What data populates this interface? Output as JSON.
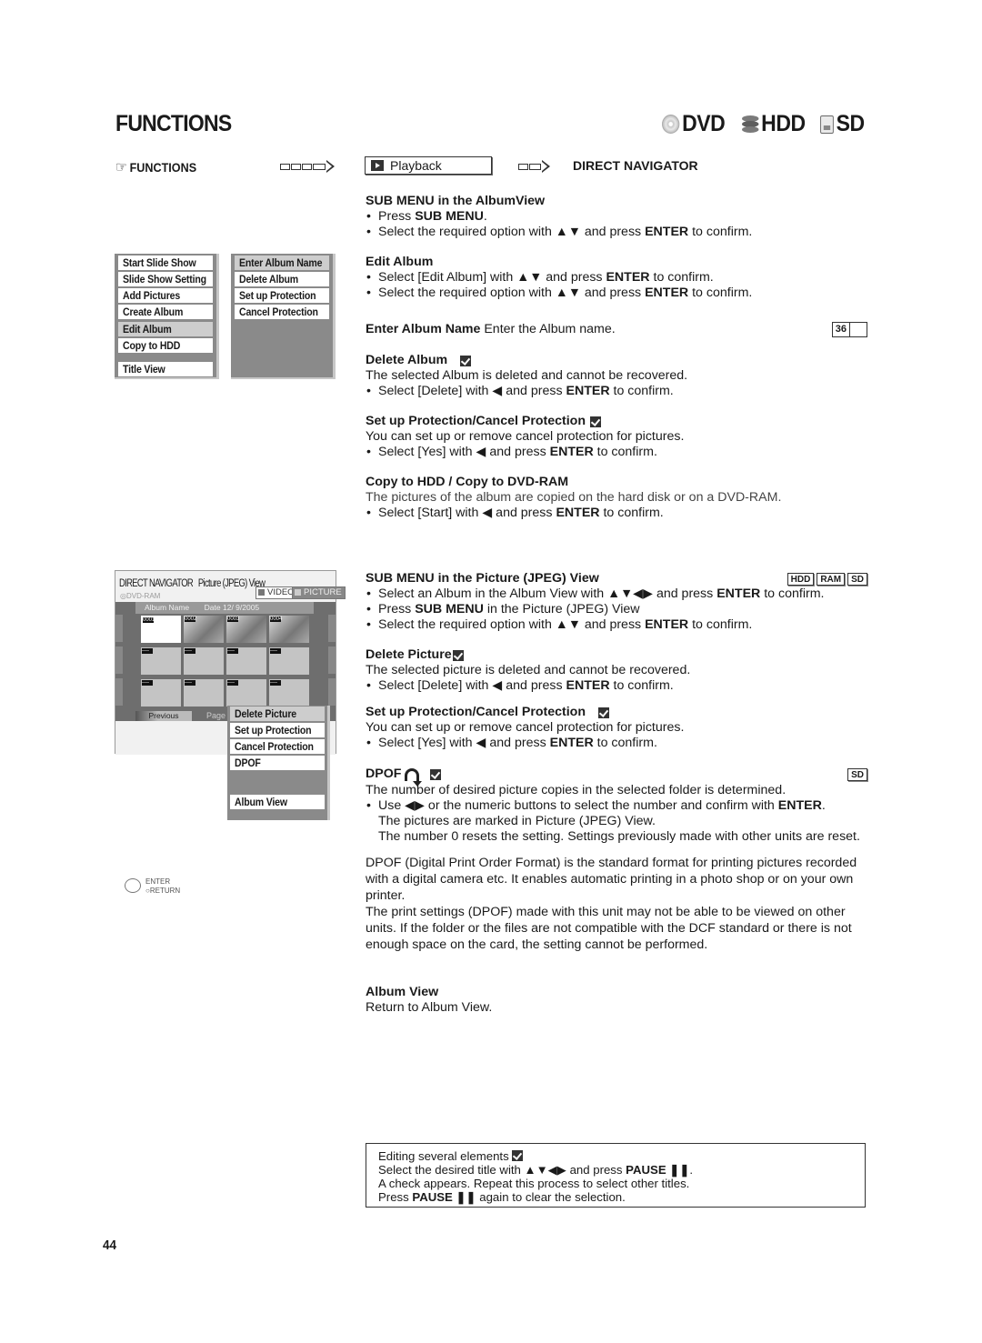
{
  "header": {
    "title": "FUNCTIONS",
    "media": [
      {
        "icon": "dvd-disc-icon",
        "label": "DVD"
      },
      {
        "icon": "hdd-icon",
        "label": "HDD"
      },
      {
        "icon": "sd-card-icon",
        "label": "SD"
      }
    ]
  },
  "nav_path": {
    "start": "FUNCTIONS",
    "middle": "Playback",
    "end": "DIRECT NAVIGATOR"
  },
  "album_menu": {
    "items": [
      "Start Slide Show",
      "Slide Show Setting",
      "Add Pictures",
      "Create Album",
      "Edit Album",
      "Copy to HDD",
      "Title View"
    ],
    "selected": "Edit Album"
  },
  "edit_album_menu": {
    "items": [
      "Enter Album Name",
      "Delete Album",
      "Set up Protection",
      "Cancel Protection"
    ],
    "selected": "Enter Album Name"
  },
  "screen": {
    "title": "DIRECT NAVIGATOR",
    "subtitle": "Picture (JPEG) View",
    "media": "DVD-RAM",
    "tab_video": "VIDEO",
    "tab_picture": "PICTURE",
    "album_name_label": "Album Name",
    "date_label": "Date  12/ 9/2005",
    "thumbnails": [
      "0001",
      "0002",
      "0003",
      "0004",
      "----",
      "----",
      "----",
      "----",
      "----",
      "----",
      "----",
      "----"
    ],
    "previous_label": "Previous",
    "page_label": "Page 0",
    "enter_label": "ENTER",
    "return_label": "RETURN"
  },
  "picture_menu": {
    "items": [
      "Delete Picture",
      "Set up Protection",
      "Cancel Protection",
      "DPOF",
      "Album View"
    ],
    "selected": "Delete Picture"
  },
  "sections": {
    "album_view": {
      "heading": "SUB MENU in the AlbumView",
      "b1_pre": "Press ",
      "b1_bold": "SUB MENU",
      "b1_post": ".",
      "b2_pre": "Select the required option with  ▲▼ and press ",
      "b2_bold": "ENTER",
      "b2_post": " to confirm."
    },
    "edit_album": {
      "heading": "Edit Album",
      "b1_pre": "Select [Edit Album] with ▲▼  and press ",
      "b1_bold": "ENTER",
      "b1_post": " to confirm.",
      "b2_pre": "Select the required option with ▲▼ and press ",
      "b2_bold": "ENTER",
      "b2_post": " to confirm."
    },
    "enter_album_name": {
      "heading": "Enter Album Name",
      "text": " Enter the Album name.",
      "page_ref": "36"
    },
    "delete_album": {
      "heading": "Delete Album",
      "text": "The selected Album is deleted and cannot be recovered.",
      "b1_pre": "Select [Delete] with ◀ and press ",
      "b1_bold": "ENTER",
      "b1_post": " to confirm."
    },
    "protection_album": {
      "heading": "Set up Protection/Cancel Protection",
      "text": "You can set up or remove cancel protection for pictures.",
      "b1_pre": "Select [Yes] with ◀ and press ",
      "b1_bold": "ENTER",
      "b1_post": " to confirm."
    },
    "copy": {
      "heading": "Copy to HDD / Copy to DVD-RAM",
      "text": "The pictures of the album are copied on the hard disk or on a DVD-RAM.",
      "b1_pre": "Select [Start] with ◀  and press ",
      "b1_bold": "ENTER",
      "b1_post": " to confirm."
    },
    "jpeg_view": {
      "heading": "SUB MENU in the Picture (JPEG) View",
      "badges": [
        "HDD",
        "RAM",
        "SD"
      ],
      "b1_pre": "Select an Album in the  Album View with ▲▼◀▶  and press  ",
      "b1_bold": "ENTER",
      "b1_post": " to confirm.",
      "b2_pre": "Press ",
      "b2_bold": "SUB MENU",
      "b2_post": " in the Picture (JPEG) View",
      "b3_pre": "Select the required option with ▲▼ and press ",
      "b3_bold": "ENTER",
      "b3_post": " to confirm."
    },
    "delete_picture": {
      "heading": "Delete Picture",
      "text": "The selected picture is deleted and cannot be recovered.",
      "b1_pre": "Select [Delete] with ◀ and press ",
      "b1_bold": "ENTER",
      "b1_post": " to confirm."
    },
    "protection_picture": {
      "heading": "Set up Protection/Cancel Protection",
      "text": "You can set up or remove cancel protection for pictures.",
      "b1_pre": "Select [Yes] with ◀ and press ",
      "b1_bold": "ENTER",
      "b1_post": " to confirm."
    },
    "dpof": {
      "heading": "DPOF",
      "badge": "SD",
      "text": "The number of desired picture copies in the selected folder is determined.",
      "b1_pre": "Use ◀▶ or the numeric buttons to select the number and confirm with ",
      "b1_bold": "ENTER",
      "b1_post": ".",
      "ind1": "The pictures are marked in Picture (JPEG) View.",
      "ind2": "The number 0 resets the setting. Settings previously made with other units are reset.",
      "para1": "DPOF (Digital Print Order Format) is the standard format for printing pictures recorded with a digital camera etc. It enables automatic printing in a photo shop or on your own printer.",
      "para2": "The print settings (DPOF) made with this unit may not be able to be viewed on other units. If the folder or the files are not compatible with the DCF standard or there is not enough space on the card, the setting cannot be performed."
    },
    "album_view_return": {
      "heading": "Album View",
      "text": "Return to Album View."
    }
  },
  "note": {
    "line1": "Editing several elements ",
    "line2_pre": "Select the desired title with ▲▼◀▶ and press ",
    "line2_bold": "PAUSE ❚❚",
    "line2_post": ".",
    "line3": "A check appears. Repeat this process to select other titles.",
    "line4_pre": "Press ",
    "line4_bold": "PAUSE ❚❚",
    "line4_post": " again to clear the selection."
  },
  "page_number": "44"
}
